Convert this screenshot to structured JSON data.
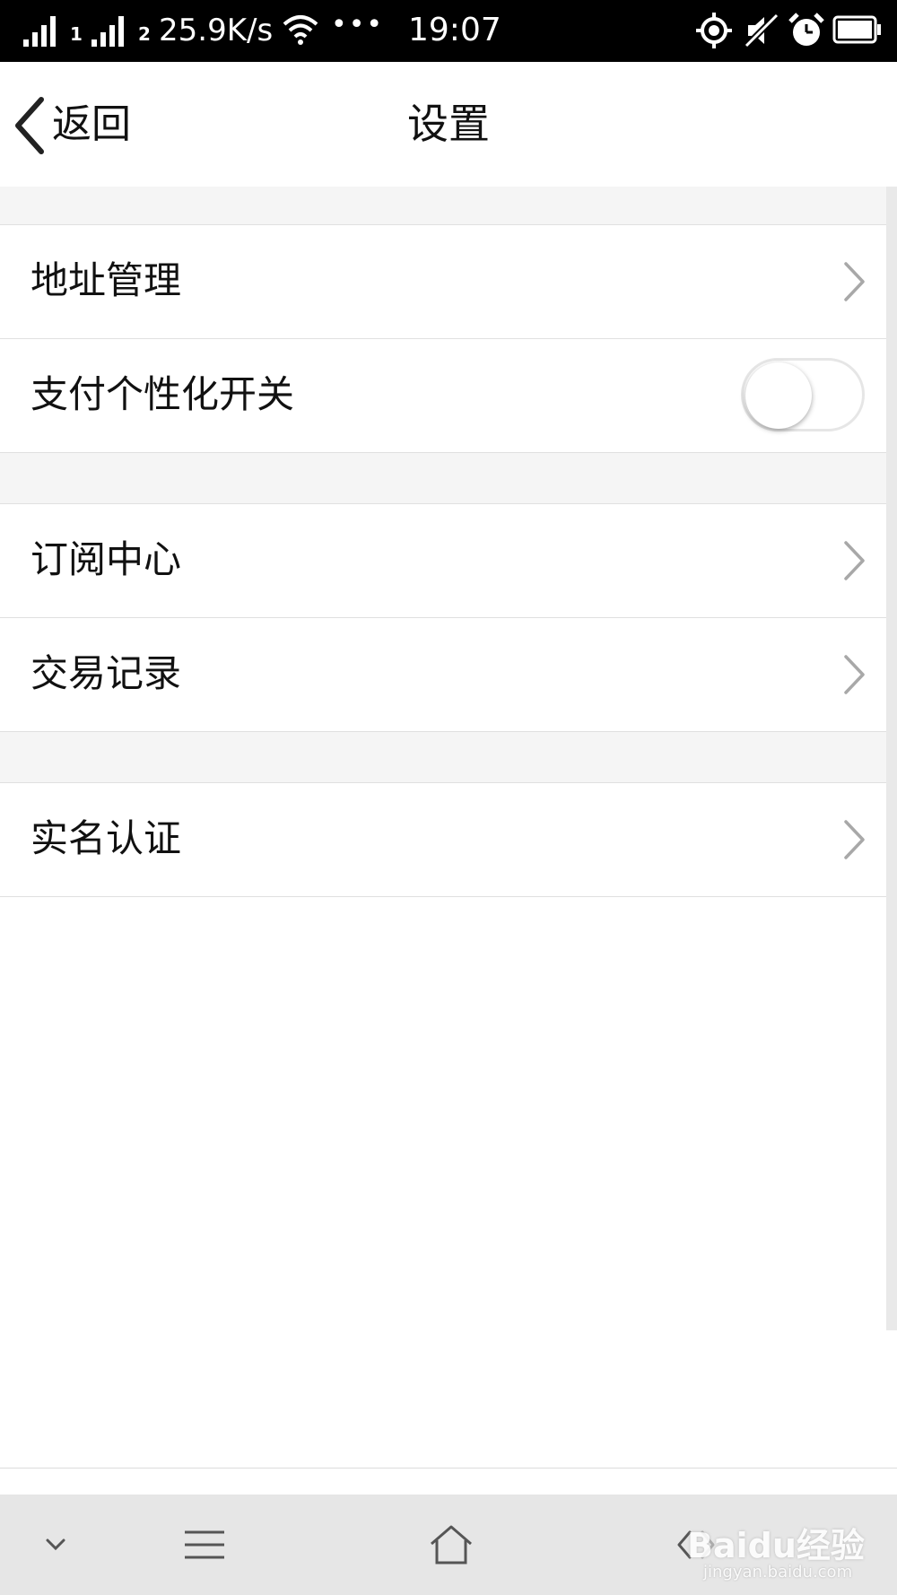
{
  "status_bar": {
    "sim1_label": "1",
    "sim2_label": "2",
    "network_speed": "25.9K/s",
    "more_dots": "•••",
    "time": "19:07",
    "icons": [
      "signal-icon",
      "wifi-icon",
      "gps-icon",
      "mute-icon",
      "alarm-icon",
      "battery-icon"
    ]
  },
  "nav": {
    "back_label": "返回",
    "title": "设置"
  },
  "sections": [
    {
      "rows": [
        {
          "label": "地址管理",
          "control": "chevron"
        },
        {
          "label": "支付个性化开关",
          "control": "toggle",
          "toggle_on": false
        }
      ]
    },
    {
      "rows": [
        {
          "label": "订阅中心",
          "control": "chevron"
        },
        {
          "label": "交易记录",
          "control": "chevron"
        }
      ]
    },
    {
      "rows": [
        {
          "label": "实名认证",
          "control": "chevron"
        }
      ]
    }
  ],
  "toolbar": {
    "icons": [
      "chevron-down-icon",
      "menu-icon",
      "home-icon",
      "back-arrow-icon"
    ]
  },
  "watermark": {
    "text": "Baidu经验",
    "sub": "jingyan.baidu.com"
  },
  "colors": {
    "status_bar": "#000000",
    "section_gap": "#f5f5f5",
    "divider": "#e0e0e0",
    "toolbar": "#e6e6e6"
  }
}
